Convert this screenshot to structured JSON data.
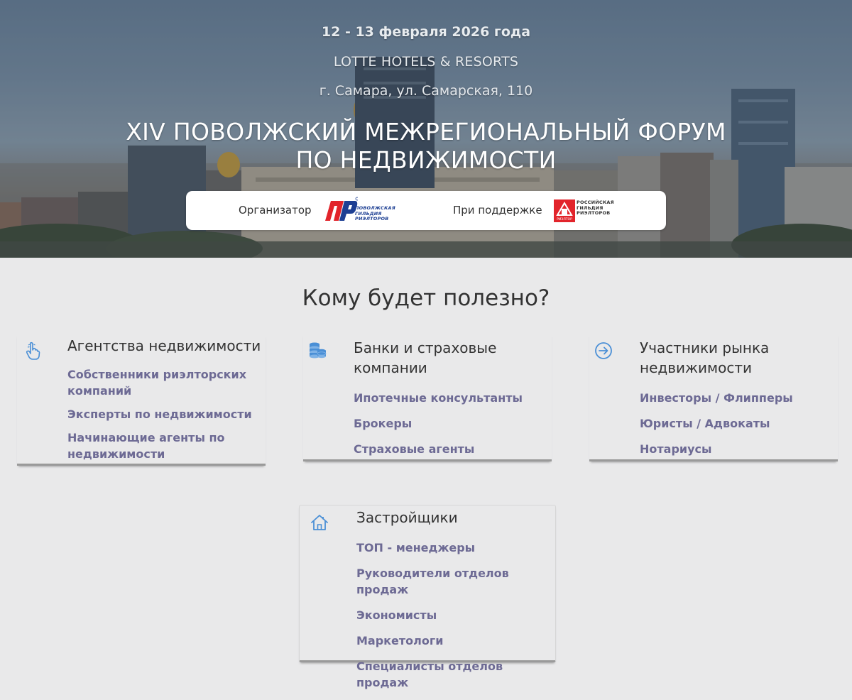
{
  "hero": {
    "date": "12 - 13 февраля 2026 года",
    "venue": "LOTTE HOTELS & RESORTS",
    "address": "г. Самара, ул. Самарская, 110",
    "title_line1": "XIV ПОВОЛЖСКИЙ МЕЖРЕГИОНАЛЬНЫЙ ФОРУМ",
    "title_line2": "ПО НЕДВИЖИМОСТИ"
  },
  "sponsors": {
    "organizer_label": "Организатор",
    "organizer_logo_text": [
      "ПОВОЛЖСКАЯ",
      "ГИЛЬДИЯ",
      "РИЭЛТОРОВ"
    ],
    "support_label": "При поддержке",
    "support_logo_text": [
      "РОССИЙСКАЯ",
      "ГИЛЬДИЯ",
      "РИЭЛТОРОВ"
    ],
    "support_logo_badge": "РИЭЛТОР"
  },
  "section": {
    "title": "Кому будет полезно?"
  },
  "cards": [
    {
      "title": "Агентства недвижимости",
      "icon": "pointing-hand-icon",
      "items": [
        "Собственники риэлторских компаний",
        "Эксперты по недвижимости",
        "Начинающие агенты по недвижимости"
      ]
    },
    {
      "title": "Банки и страховые компании",
      "icon": "coins-stack-icon",
      "items": [
        "Ипотечные консультанты",
        "Брокеры",
        "Страховые агенты"
      ]
    },
    {
      "title": "Участники рынка недвижимости",
      "icon": "arrow-circle-icon",
      "items": [
        "Инвесторы / Флипперы",
        "Юристы / Адвокаты",
        "Нотариусы"
      ]
    },
    {
      "title": "Застройщики",
      "icon": "house-icon",
      "items": [
        "ТОП - менеджеры",
        "Руководители отделов продаж",
        "Экономисты",
        "Маркетологи",
        "Специалисты отделов продаж"
      ]
    }
  ],
  "colors": {
    "link": "#6d6a94",
    "icon": "#4a8fd6",
    "pgr_red": "#e2242b",
    "pgr_blue": "#1d3f93"
  }
}
